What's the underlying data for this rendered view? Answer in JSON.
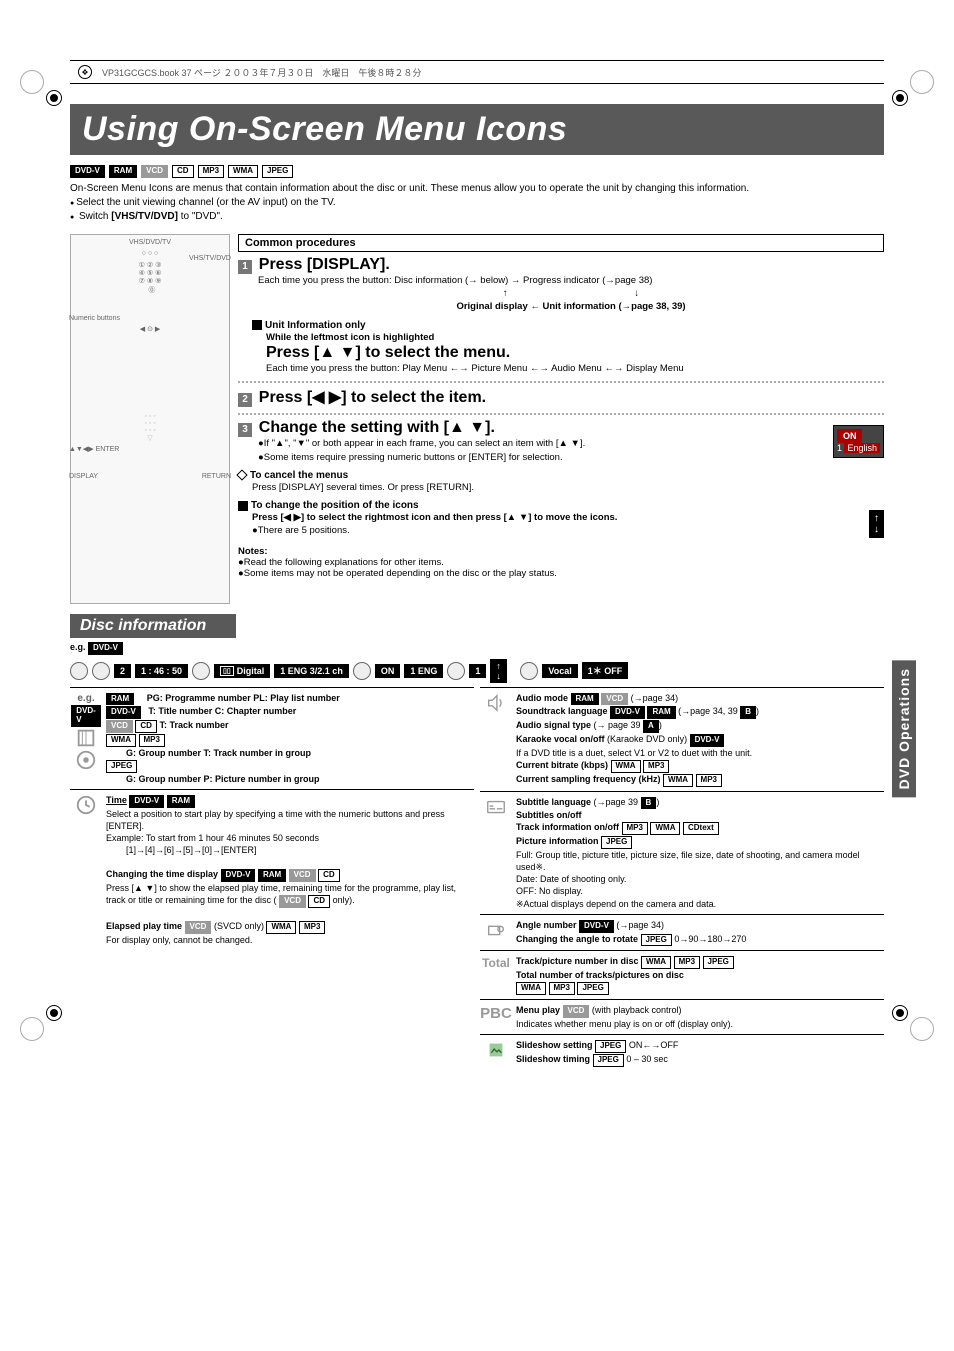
{
  "topbar": {
    "filename": "VP31GCGCS.book 37 ページ ２００３年７月３０日　水曜日　午後８時２８分"
  },
  "title": "Using On-Screen Menu Icons",
  "formats_top": [
    "DVD-V",
    "RAM",
    "VCD",
    "CD",
    "MP3",
    "WMA",
    "JPEG"
  ],
  "intro1": "On-Screen Menu Icons are menus that contain information about the disc or unit. These menus allow you to operate the unit by changing this information.",
  "intro2": "Select the unit viewing channel (or the AV input) on the TV.",
  "intro3a": "Switch ",
  "intro3b": "[VHS/TV/DVD]",
  "intro3c": " to \"DVD\".",
  "remote": {
    "heading": "VHS/DVD/TV",
    "label_numeric": "Numeric buttons",
    "label_enter": "▲▼◀▶ ENTER",
    "label_display": "DISPLAY",
    "label_return": "RETURN",
    "side_vhs": "VHS/TV/DVD"
  },
  "common_procedures": "Common procedures",
  "step1": {
    "num": "1",
    "head": "Press [DISPLAY].",
    "line1": "Each time you press the button: Disc information (→ below) → Progress indicator (→page 38)",
    "line2": "Original display ← Unit information (→page 38, 39)"
  },
  "unitinfo": {
    "hd": "Unit Information only",
    "sub": "While the leftmost icon is highlighted",
    "head": "Press [▲ ▼] to select the menu.",
    "line": "Each time you press the button: Play Menu ←→ Picture Menu ←→ Audio Menu ←→ Display Menu"
  },
  "step2": {
    "num": "2",
    "head": "Press [◀ ▶] to select the item."
  },
  "step3": {
    "num": "3",
    "head": "Change the setting with [▲ ▼].",
    "b1": "If \"▲\", \"▼\" or both appear in each frame, you can select an item with [▲ ▼].",
    "b2": "Some items require pressing numeric buttons or [ENTER] for selection.",
    "osd_on": "ON",
    "osd_lang": "English",
    "osd_lang_no": "1"
  },
  "cancel": {
    "hd": "To cancel the menus",
    "body": "Press [DISPLAY] several times. Or press [RETURN]."
  },
  "changepos": {
    "hd": "To change the position of the icons",
    "line": "Press [◀ ▶] to select the rightmost icon and then press [▲ ▼] to move the icons.",
    "sub": "There are 5 positions."
  },
  "notes": {
    "hd": "Notes:",
    "a": "Read the following explanations for other items.",
    "b": "Some items may not be operated depending on the disc or the play status."
  },
  "disc_info": "Disc information",
  "eg_label": "e.g.",
  "eg_badge": "DVD-V",
  "osd": {
    "seg1": "2",
    "seg2": "1 : 46 : 50",
    "seg3a": "Digital",
    "seg3b": "1 ENG  3/2.1 ch",
    "seg4a": "ON",
    "seg4b": "1 ENG",
    "seg5": "1",
    "vocal": "Vocal",
    "vocal_val": "1＊    OFF"
  },
  "left_col": {
    "cell1": {
      "eg": "e.g.",
      "f": [
        "RAM",
        "DVD-V",
        "VCD",
        "CD",
        "WMA",
        "MP3",
        "JPEG"
      ],
      "l1": "PG: Programme number  PL: Play list number",
      "l2": "T: Title number          C: Chapter number",
      "l3": "T: Track number",
      "l4": "G: Group number    T: Track number in group",
      "l5": "G: Group number    P: Picture number in group"
    },
    "cell2": {
      "hd": "Time",
      "f1": [
        "DVD-V",
        "RAM"
      ],
      "l1": "Select a position to start play by specifying a time with the numeric buttons and press [ENTER].",
      "l2": "Example: To start from 1 hour 46 minutes 50 seconds",
      "l3": "[1]→[4]→[6]→[5]→[0]→[ENTER]",
      "hd2": "Changing the time display",
      "f2": [
        "DVD-V",
        "RAM",
        "VCD",
        "CD"
      ],
      "l4": "Press [▲ ▼] to show the elapsed play time, remaining time for the programme, play list, track or title or remaining time for the disc (",
      "f2b": [
        "VCD",
        "CD"
      ],
      "l4b": " only).",
      "hd3": "Elapsed play time",
      "f3": [
        "VCD"
      ],
      "l5a": " (SVCD only) ",
      "f3b": [
        "WMA",
        "MP3"
      ],
      "l6": "For display only, cannot be changed."
    }
  },
  "right_col": {
    "cell1": {
      "l1a": "Audio mode ",
      "f1": [
        "RAM",
        "VCD"
      ],
      "l1b": " (→page 34)",
      "l2a": "Soundtrack language ",
      "f2": [
        "DVD-V",
        "RAM"
      ],
      "l2b": " (→page 34, 39 ",
      "badgeB": "B",
      "l2c": ")",
      "l3a": "Audio signal type",
      "l3b": " (→ page 39 ",
      "badgeA": "A",
      "l3c": ")",
      "l4a": "Karaoke vocal on/off",
      "l4b": " (Karaoke DVD only) ",
      "f4": [
        "DVD-V"
      ],
      "l5": "If a DVD title is a duet, select V1 or V2 to duet with the unit.",
      "l6a": "Current bitrate (kbps) ",
      "f6": [
        "WMA",
        "MP3"
      ],
      "l7a": "Current sampling frequency (kHz) ",
      "f7": [
        "WMA",
        "MP3"
      ]
    },
    "cell2": {
      "l1a": "Subtitle language",
      "l1b": " (→page 39 ",
      "badgeB": "B",
      "l1c": ")",
      "l2": "Subtitles on/off",
      "l3a": "Track information on/off ",
      "f3": [
        "MP3",
        "WMA",
        "CDtext"
      ],
      "l4a": "Picture information ",
      "f4": [
        "JPEG"
      ],
      "l5": "Full:    Group title, picture title, picture size, file size, date of shooting, and camera model used※.",
      "l6": "Date:   Date of shooting only.",
      "l7": "OFF:   No display.",
      "l8": "※Actual displays depend on the camera and data."
    },
    "cell3": {
      "l1a": "Angle number ",
      "f1": [
        "DVD-V"
      ],
      "l1b": " (→page 34)",
      "l2a": "Changing the angle to rotate ",
      "f2": [
        "JPEG"
      ],
      "l2b": " 0→90→180→270"
    },
    "cell4": {
      "icon": "Total",
      "l1a": "Track/picture number in disc ",
      "f1": [
        "WMA",
        "MP3",
        "JPEG"
      ],
      "l2": "Total number of tracks/pictures on disc",
      "f2": [
        "WMA",
        "MP3",
        "JPEG"
      ]
    },
    "cell5": {
      "icon": "PBC",
      "l1a": "Menu play ",
      "f1": [
        "VCD"
      ],
      "l1b": " (with playback control)",
      "l2": "Indicates whether menu play is on or off (display only)."
    },
    "cell6": {
      "l1a": "Slideshow setting ",
      "f1": [
        "JPEG"
      ],
      "l1b": "   ON←→OFF",
      "l2a": "Slideshow timing ",
      "f2": [
        "JPEG"
      ],
      "l2b": "    0 – 30 sec"
    }
  },
  "sidetab": "DVD Operations"
}
